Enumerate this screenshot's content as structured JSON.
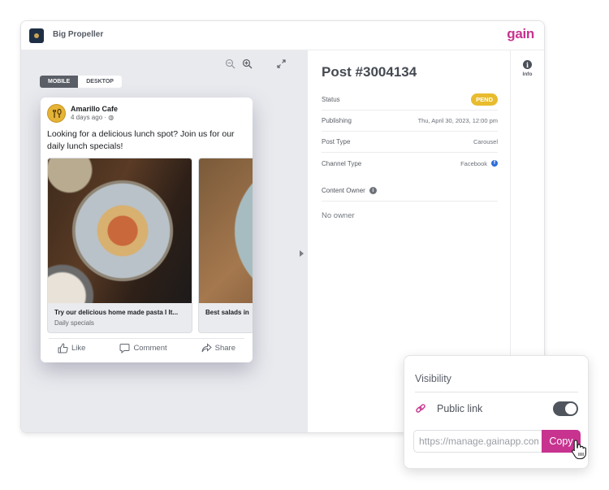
{
  "app": {
    "org_name": "Big Propeller",
    "brand": "gain",
    "brand_color": "#c7338f"
  },
  "preview": {
    "zoom_out_icon": "zoom-out-icon",
    "zoom_in_icon": "zoom-in-icon",
    "expand_icon": "expand-icon",
    "view_modes": [
      {
        "label": "MOBILE",
        "active": true
      },
      {
        "label": "DESKTOP",
        "active": false
      }
    ],
    "post": {
      "page_name": "Amarillo Cafe",
      "meta": "4 days ago · ◍",
      "text": "Looking for a delicious lunch spot? Join us for our daily lunch specials!",
      "slides": [
        {
          "title": "Try our delicious home made pasta I It...",
          "subtitle": "Daily specials"
        },
        {
          "title": "Best salads in",
          "subtitle": ""
        }
      ],
      "actions": [
        {
          "label": "Like",
          "icon": "thumbs-up-icon"
        },
        {
          "label": "Comment",
          "icon": "comment-icon"
        },
        {
          "label": "Share",
          "icon": "share-icon"
        }
      ]
    }
  },
  "details": {
    "title": "Post #3004134",
    "rows": [
      {
        "label": "Status",
        "value": "PEND",
        "badge_color": "#e8bc2e"
      },
      {
        "label": "Publishing",
        "value": "Thu, April 30, 2023, 12:00 pm"
      },
      {
        "label": "Post Type",
        "value": "Carousel"
      },
      {
        "label": "Channel Type",
        "value": "Facebook"
      }
    ],
    "content_owner_label": "Content Owner",
    "content_owner_value": "No owner"
  },
  "side_rail": {
    "items": [
      {
        "label": "Info",
        "icon": "info-icon"
      }
    ]
  },
  "visibility": {
    "title": "Visibility",
    "public_link_label": "Public link",
    "public_link_enabled": true,
    "link_value": "https://manage.gainapp.com",
    "copy_label": "Copy"
  }
}
